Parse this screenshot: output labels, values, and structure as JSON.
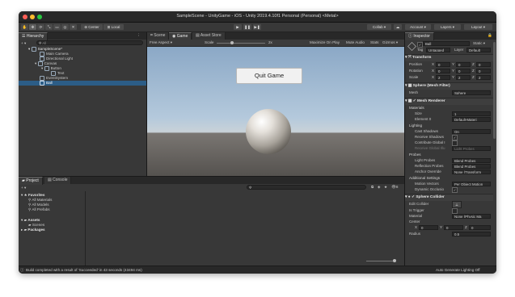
{
  "window": {
    "title": "SampleScene - UnityGame - iOS - Unity 2019.4.10f1 Personal (Personal) <Metal>",
    "traffic_colors": {
      "close": "#fe5f57",
      "min": "#febc2e",
      "max": "#28c840"
    }
  },
  "toolbar": {
    "pivot_label": "Center",
    "space_label": "Local",
    "collab_label": "Collab ▾",
    "account_label": "Account ▾",
    "layers_label": "Layers ▾",
    "layout_label": "Layout ▾"
  },
  "hierarchy": {
    "tab_label": "Hierarchy",
    "add_label": "+ ▾",
    "search_placeholder": "All",
    "items": [
      {
        "label": "SampleScene*"
      },
      {
        "label": "Main Camera"
      },
      {
        "label": "Directional Light"
      },
      {
        "label": "Canvas"
      },
      {
        "label": "Button"
      },
      {
        "label": "Text"
      },
      {
        "label": "EventSystem"
      },
      {
        "label": "Ball"
      }
    ]
  },
  "scene": {
    "tabs": [
      {
        "label": "Scene"
      },
      {
        "label": "Game"
      },
      {
        "label": "Asset Store"
      }
    ],
    "aspect_label": "Free Aspect",
    "scale_label": "Scale",
    "scale_value": "2x",
    "maximize_label": "Maximize On Play",
    "mute_label": "Mute Audio",
    "stats_label": "Stats",
    "gizmos_label": "Gizmos ▾",
    "button_text": "Quit Game",
    "sky_color": "#a7bfd6",
    "ground_color": "#5c5a58"
  },
  "project": {
    "tabs": [
      {
        "label": "Project"
      },
      {
        "label": "Console"
      }
    ],
    "add_label": "+ ▾",
    "favorites_label": "Favorites",
    "favorites": [
      {
        "label": "All Materials"
      },
      {
        "label": "All Models"
      },
      {
        "label": "All Prefabs"
      }
    ],
    "assets_label": "Assets",
    "assets_children": [
      {
        "label": "Scenes"
      }
    ],
    "packages_label": "Packages",
    "count_label": "8"
  },
  "inspector": {
    "tab_label": "Inspector",
    "object_name": "Ball",
    "static_label": "Static ▾",
    "tag_label": "Tag",
    "tag_value": "Untagged",
    "layer_label": "Layer",
    "layer_value": "Default",
    "transform": {
      "title": "Transform",
      "position_label": "Position",
      "rotation_label": "Rotation",
      "scale_label": "Scale",
      "position": {
        "x": "0",
        "y": "0",
        "z": "0"
      },
      "rotation": {
        "x": "0",
        "y": "0",
        "z": "0"
      },
      "scale": {
        "x": "2",
        "y": "2",
        "z": "2"
      },
      "x_label": "X",
      "y_label": "Y",
      "z_label": "Z"
    },
    "mesh_filter": {
      "title": "Sphere (Mesh Filter)",
      "mesh_label": "Mesh",
      "mesh_value": "Sphere"
    },
    "mesh_renderer": {
      "title": "Mesh Renderer",
      "materials_label": "Materials",
      "size_label": "Size",
      "size_value": "1",
      "element_label": "Element 0",
      "element_value": "Default-Materi",
      "lighting_label": "Lighting",
      "cast_label": "Cast Shadows",
      "cast_value": "On",
      "receive_label": "Receive Shadows",
      "contribute_label": "Contribute Global I",
      "receive_gi_label": "Receive Global Illu",
      "receive_gi_value": "Light Probes",
      "probes_label": "Probes",
      "light_probes_label": "Light Probes",
      "light_probes_value": "Blend Probes",
      "reflection_label": "Reflection Probes",
      "reflection_value": "Blend Probes",
      "anchor_label": "Anchor Override",
      "anchor_value": "None (Transform",
      "additional_label": "Additional Settings",
      "motion_label": "Motion Vectors",
      "motion_value": "Per Object Motion",
      "occlusion_label": "Dynamic Occlusio"
    },
    "sphere_collider": {
      "title": "Sphere Collider",
      "edit_label": "Edit Collider",
      "trigger_label": "Is Trigger",
      "material_label": "Material",
      "material_value": "None (Physic Ma",
      "center_label": "Center",
      "center": {
        "x": "0",
        "y": "0",
        "z": "0"
      },
      "radius_label": "Radius",
      "radius_value": "0.5"
    }
  },
  "status": {
    "message": "Build completed with a result of 'Succeeded' in 43 seconds (43494 ms)",
    "right_label": "Auto Generate Lighting Off"
  }
}
